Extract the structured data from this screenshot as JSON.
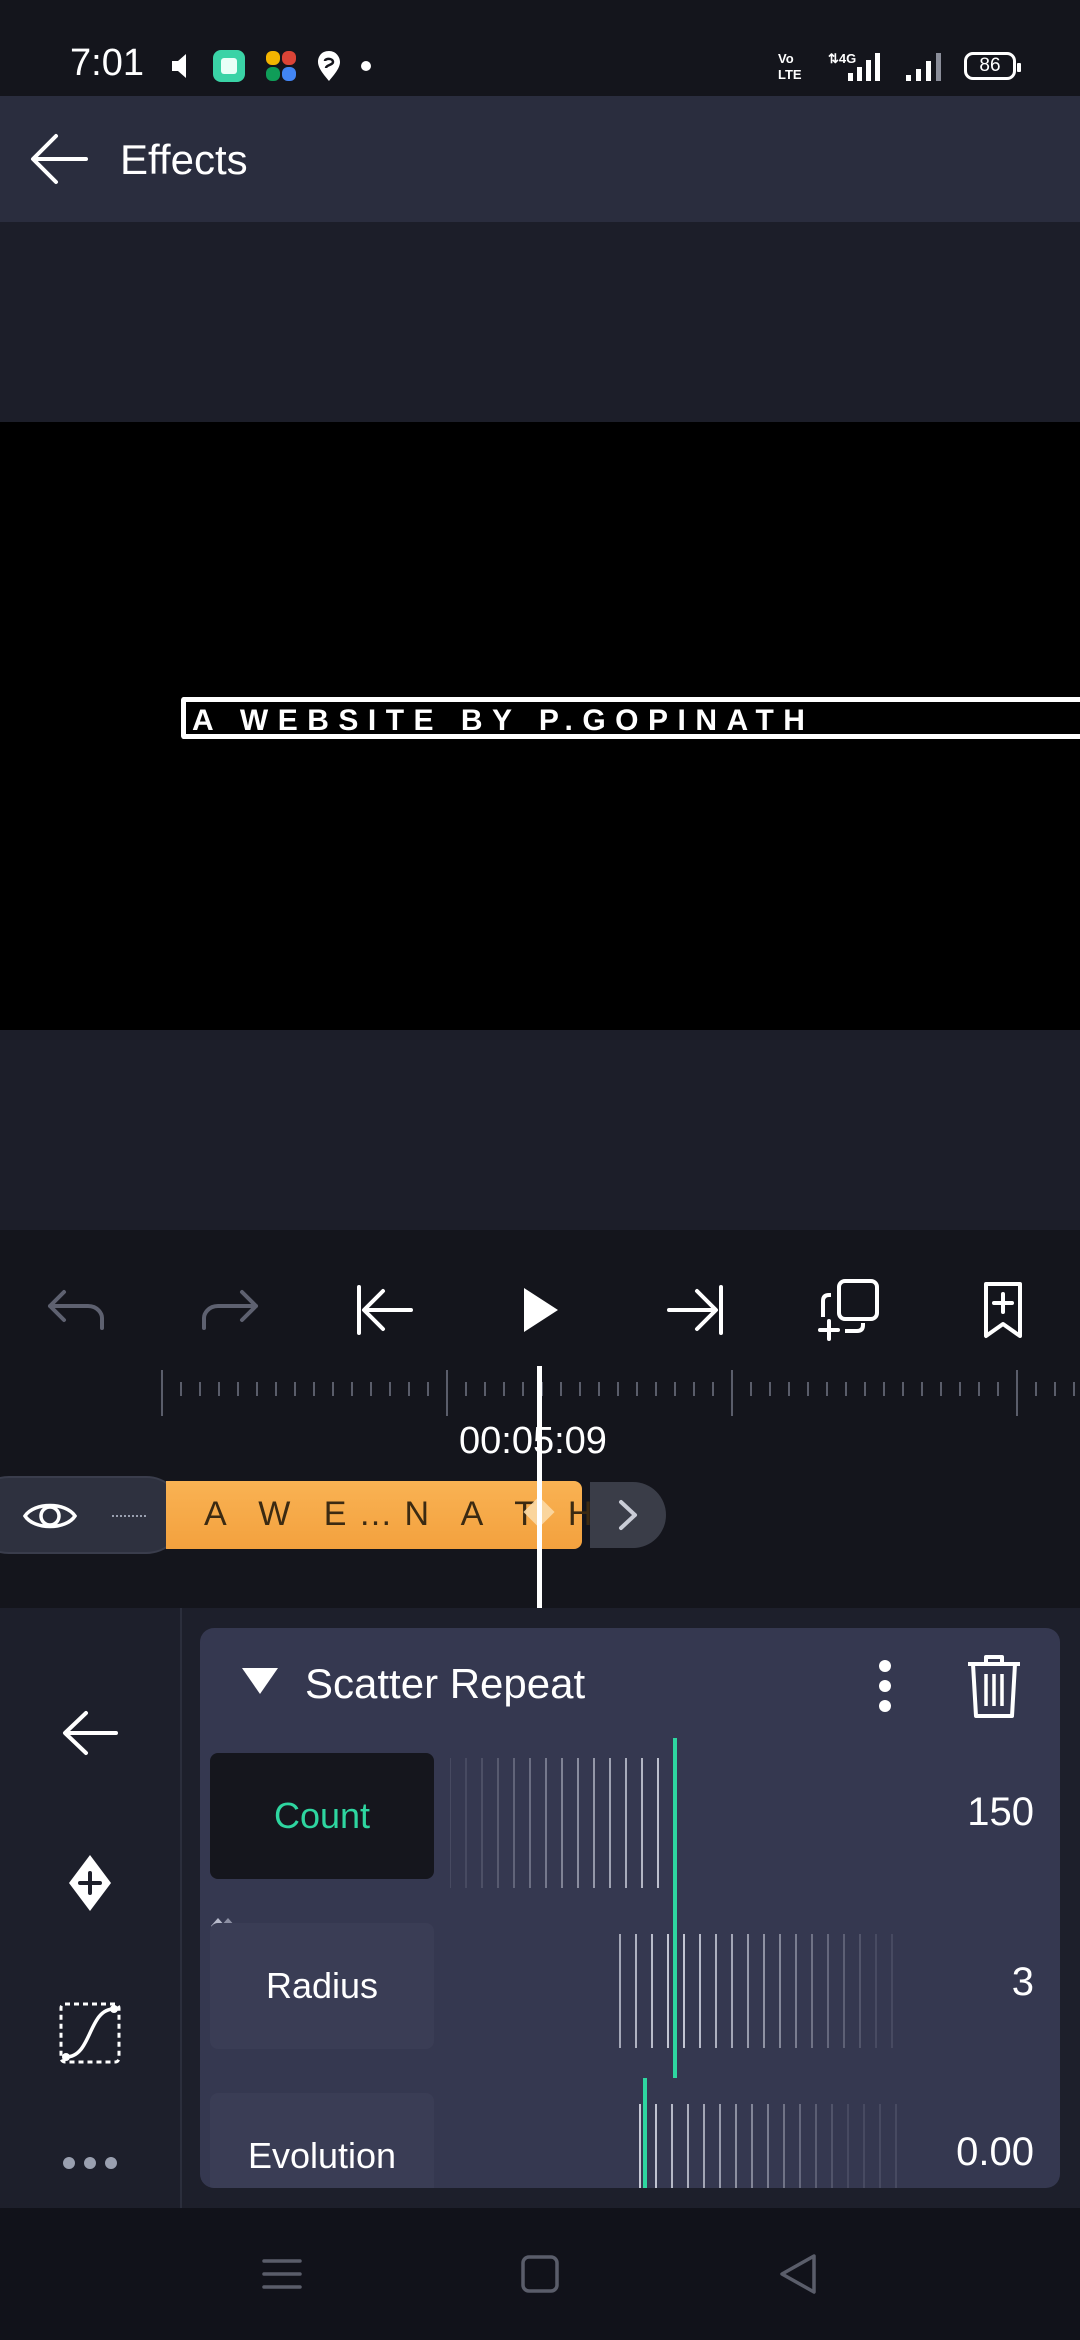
{
  "status": {
    "time": "7:01",
    "battery": "86",
    "volte": "Vo LTE",
    "network": "4G"
  },
  "header": {
    "title": "Effects"
  },
  "preview": {
    "overlay_text": "A WEBSITE BY P.GOPINATH"
  },
  "toolbar": {
    "buttons": [
      "undo-icon",
      "redo-icon",
      "skip-to-start-icon",
      "play-icon",
      "skip-to-end-icon",
      "duplicate-icon",
      "bookmark-add-icon"
    ]
  },
  "timeline": {
    "timecode": "00:05:09",
    "clip_label": "A W E…N A T H"
  },
  "effect": {
    "name": "Scatter Repeat",
    "params": [
      {
        "label": "Count",
        "value": "150",
        "active": true
      },
      {
        "label": "Radius",
        "value": "3",
        "active": false
      },
      {
        "label": "Evolution",
        "value": "0.00",
        "active": false
      }
    ]
  },
  "colors": {
    "accent": "#2ed6a0",
    "clip": "#f6a845",
    "panel": "#353850",
    "header": "#2a2d3e"
  }
}
